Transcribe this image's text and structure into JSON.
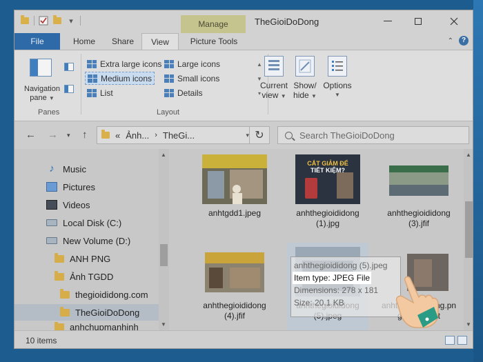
{
  "window": {
    "title": "TheGioiDoDong",
    "manage_tab": "Manage"
  },
  "ribbon_tabs": {
    "file": "File",
    "home": "Home",
    "share": "Share",
    "view": "View",
    "picture_tools": "Picture Tools"
  },
  "ribbon": {
    "panes": {
      "navigation_pane_line1": "Navigation",
      "navigation_pane_line2": "pane",
      "group_label": "Panes"
    },
    "layout": {
      "group_label": "Layout",
      "items": {
        "extra_large": "Extra large icons",
        "large": "Large icons",
        "medium": "Medium icons",
        "small": "Small icons",
        "list": "List",
        "details": "Details"
      }
    },
    "current_view_line1": "Current",
    "current_view_line2": "view",
    "show_hide_line1": "Show/",
    "show_hide_line2": "hide",
    "options": "Options"
  },
  "address": {
    "prefix": "«",
    "segment1": "Ảnh...",
    "segment2": "TheGi...",
    "search_placeholder": "Search TheGioiDoDong"
  },
  "nav_pane": {
    "items": [
      {
        "label": "Music",
        "icon": "music-icon"
      },
      {
        "label": "Pictures",
        "icon": "pictures-icon"
      },
      {
        "label": "Videos",
        "icon": "videos-icon"
      },
      {
        "label": "Local Disk (C:)",
        "icon": "drive-icon"
      },
      {
        "label": "New Volume (D:)",
        "icon": "drive-icon"
      },
      {
        "label": "ANH PNG",
        "icon": "folder-icon"
      },
      {
        "label": "Ảnh TGDD",
        "icon": "folder-icon"
      },
      {
        "label": "thegioididong.com",
        "icon": "folder-icon"
      },
      {
        "label": "TheGioiDoDong",
        "icon": "folder-icon"
      },
      {
        "label": "anhchupmanhinh",
        "icon": "folder-icon"
      }
    ]
  },
  "files": [
    {
      "name": "anhtgdd1.jpeg"
    },
    {
      "name": "anhthegioididong (1).jpg"
    },
    {
      "name": "anhthegioididong (3).jfif"
    },
    {
      "name": "anhthegioididong (4).jfif"
    },
    {
      "name": "anhthegioididong (5).jpeg"
    },
    {
      "name": "anhthegioididong.png - Shortcut"
    }
  ],
  "thumb_text": {
    "cat_giam_line1": "CẮT GIẢM ĐỂ",
    "cat_giam_line2": "TIẾT KIỆM?"
  },
  "tooltip": {
    "filename": "anhthegioididong (5).jpeg",
    "item_type": "Item type: JPEG File",
    "dimensions": "Dimensions: 278 x 181",
    "size": "Size: 20.1 KB"
  },
  "status": {
    "count": "10 items"
  },
  "colors": {
    "file_tab": "#2d6aa7",
    "manage_tab": "#c6c48e",
    "selection": "#b4bcc6",
    "folder": "#d6ad48"
  }
}
